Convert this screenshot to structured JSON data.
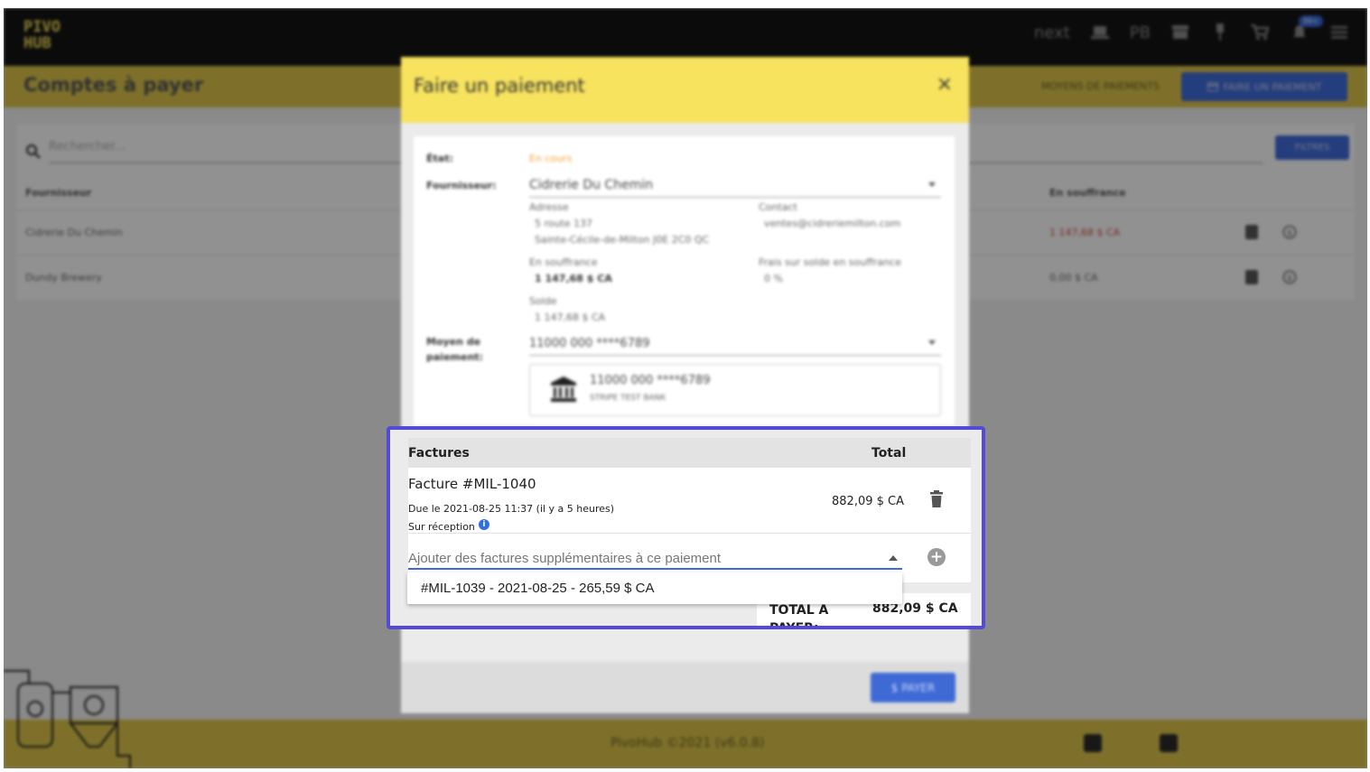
{
  "app": {
    "logo": "PIVO HUB",
    "nav": {
      "next": "next",
      "user_initials": "PB",
      "notif_badge": "99+"
    }
  },
  "page": {
    "title": "Comptes à payer",
    "tab_payment_methods": "MOYENS DE PAIEMENTS",
    "make_payment_button": "FAIRE UN PAIEMENT",
    "search_placeholder": "Rechercher...",
    "filters_button": "FILTRES",
    "col_supplier": "Fournisseur",
    "col_overdue": "En souffrance",
    "rows": [
      {
        "supplier": "Cidrerie Du Chemin",
        "overdue": "1 147,68 $ CA"
      },
      {
        "supplier": "Dundy Brewery",
        "overdue": "0,00 $ CA"
      }
    ],
    "footer": "PivoHub ©2021 (v6.0.8)"
  },
  "dialog": {
    "title": "Faire un paiement",
    "close": "×",
    "status_label": "État:",
    "status_value": "En cours",
    "supplier_label": "Fournisseur:",
    "supplier_value": "Cidrerie Du Chemin",
    "address_label": "Adresse",
    "address_line1": "5 route 137",
    "address_line2": "Sainte-Cécile-de-Milton J0E 2C0 QC",
    "contact_label": "Contact",
    "contact_value": "ventes@cidreriemilton.com",
    "overdue_label": "En souffrance",
    "overdue_value": "1 147,68 $ CA",
    "fee_label": "Frais sur solde en souffrance",
    "fee_value": "0 %",
    "balance_label": "Solde",
    "balance_value": "1 147,68 $ CA",
    "payment_method_label": "Moyen de paiement:",
    "payment_method_value": "11000 000 ****6789",
    "bank_account": "11000 000 ****6789",
    "bank_name": "STRIPE TEST BANK",
    "pay_button": "$ PAYER"
  },
  "invoices": {
    "header_invoices": "Factures",
    "header_total": "Total",
    "items": [
      {
        "title": "Facture #MIL-1040",
        "due": "Due le 2021-08-25 11:37 (il y a 5 heures)",
        "terms": "Sur réception",
        "amount": "882,09 $ CA"
      }
    ],
    "add_placeholder": "Ajouter des factures supplémentaires à ce paiement",
    "dropdown_option": "#MIL-1039 - 2021-08-25 - 265,59 $ CA",
    "total_label": "TOTAL À PAYER:",
    "total_value": "882,09 $ CA"
  }
}
